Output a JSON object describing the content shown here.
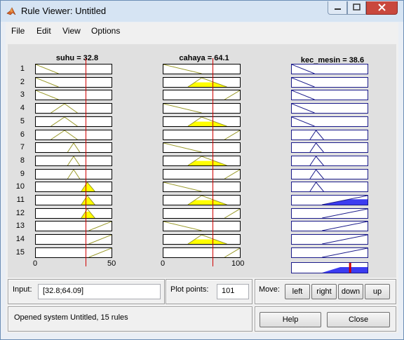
{
  "window": {
    "title": "Rule Viewer: Untitled"
  },
  "menu": {
    "file": "File",
    "edit": "Edit",
    "view": "View",
    "options": "Options"
  },
  "columns": {
    "suhu": {
      "title": "suhu = 32.8",
      "min": "0",
      "max": "50",
      "value": 32.8
    },
    "cahaya": {
      "title": "cahaya = 64.1",
      "min": "0",
      "max": "100",
      "value": 64.1
    },
    "kec_mesin": {
      "title": "kec_mesin = 38.6",
      "value": 38.6
    }
  },
  "rules": [
    "1",
    "2",
    "3",
    "4",
    "5",
    "6",
    "7",
    "8",
    "9",
    "10",
    "11",
    "12",
    "13",
    "14",
    "15"
  ],
  "input": {
    "label": "Input:",
    "value": "[32.8;64.09]"
  },
  "plot_points": {
    "label": "Plot points:",
    "value": "101"
  },
  "move": {
    "label": "Move:",
    "left": "left",
    "right": "right",
    "down": "down",
    "up": "up"
  },
  "status": {
    "text": "Opened system Untitled, 15 rules"
  },
  "buttons": {
    "help": "Help",
    "close": "Close"
  },
  "colors": {
    "input_mf": "#9a9a2a",
    "fill": "#ffff00",
    "output_mf": "#1a1a8a",
    "output_fill": "#3c3cf0",
    "value_line": "#d00000"
  }
}
